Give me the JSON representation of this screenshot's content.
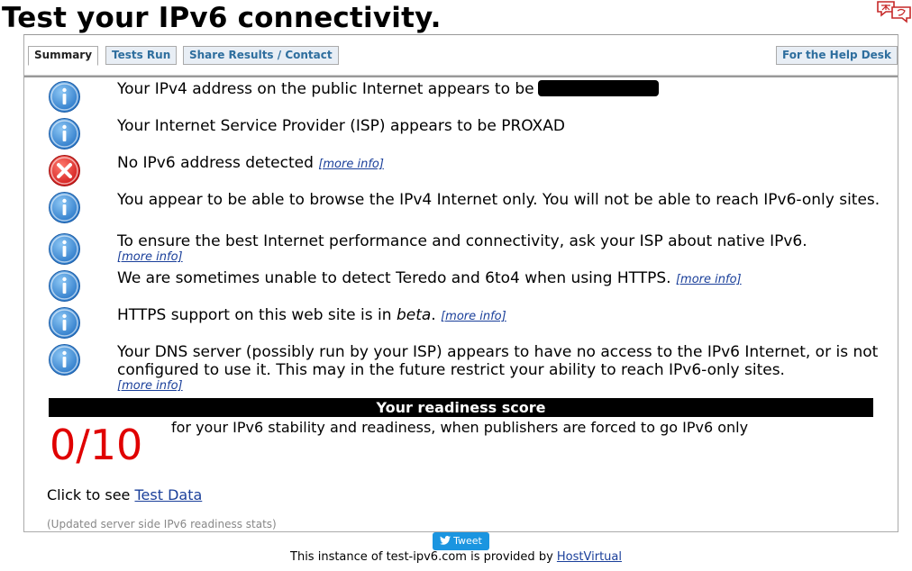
{
  "page": {
    "title": "Test your IPv6 connectivity."
  },
  "tabs": {
    "summary": "Summary",
    "tests_run": "Tests Run",
    "share": "Share Results / Contact",
    "help_desk": "For the Help Desk"
  },
  "messages": [
    {
      "icon": "info-icon",
      "text": "Your IPv4 address on the public Internet appears to be"
    },
    {
      "icon": "info-icon",
      "text": "Your Internet Service Provider (ISP) appears to be PROXAD"
    },
    {
      "icon": "error-icon",
      "text": "No IPv6 address detected",
      "more": "[more info]"
    },
    {
      "icon": "info-icon",
      "text": "You appear to be able to browse the IPv4 Internet only. You will not be able to reach IPv6-only sites."
    },
    {
      "icon": "info-icon",
      "text": "To ensure the best Internet performance and connectivity, ask your ISP about native IPv6.",
      "more": "[more info]"
    },
    {
      "icon": "info-icon",
      "text": "We are sometimes unable to detect Teredo and 6to4 when using HTTPS.",
      "more": "[more info]"
    },
    {
      "icon": "info-icon",
      "text_before": "HTTPS support on this web site is in",
      "text_em": "beta",
      "text_after": ".",
      "more": "[more info]"
    },
    {
      "icon": "info-icon",
      "text": "Your DNS server (possibly run by your ISP) appears to have no access to the IPv6 Internet, or is not configured to use it. This may in the future restrict your ability to reach IPv6-only sites.",
      "more": "[more info]"
    }
  ],
  "score": {
    "heading": "Your readiness score",
    "value": "0/10",
    "description": "for your IPv6 stability and readiness, when publishers are forced to go IPv6 only"
  },
  "click_to_see": {
    "prefix": "Click to see",
    "link": "Test Data"
  },
  "updated_stats": "(Updated server side IPv6 readiness stats)",
  "tweet_label": "Tweet",
  "footer": {
    "prefix": "This instance of test-ipv6.com is provided by",
    "link": "HostVirtual"
  },
  "colors": {
    "info_blue": "#3a8fd8",
    "error_red": "#e53935",
    "score_red": "#e00000",
    "link_blue": "#1a3f9a",
    "tweet_blue": "#1b95e0"
  }
}
